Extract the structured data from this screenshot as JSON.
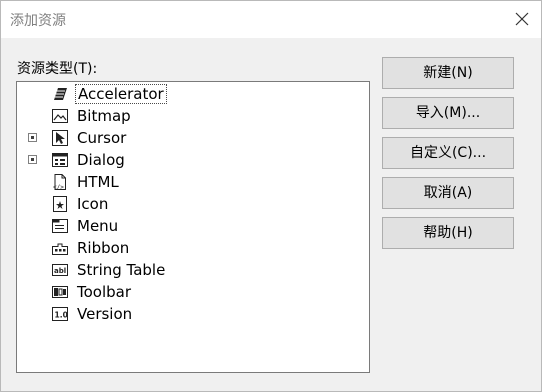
{
  "window": {
    "title": "添加资源"
  },
  "resource_types_label": "资源类型(T):",
  "tree": {
    "items": [
      {
        "label": "Accelerator",
        "icon": "accelerator-icon",
        "selected": true,
        "expandable": false
      },
      {
        "label": "Bitmap",
        "icon": "bitmap-icon",
        "selected": false,
        "expandable": false
      },
      {
        "label": "Cursor",
        "icon": "cursor-icon",
        "selected": false,
        "expandable": true
      },
      {
        "label": "Dialog",
        "icon": "dialog-icon",
        "selected": false,
        "expandable": true
      },
      {
        "label": "HTML",
        "icon": "html-icon",
        "selected": false,
        "expandable": false
      },
      {
        "label": "Icon",
        "icon": "icon-resource-icon",
        "selected": false,
        "expandable": false
      },
      {
        "label": "Menu",
        "icon": "menu-icon",
        "selected": false,
        "expandable": false
      },
      {
        "label": "Ribbon",
        "icon": "ribbon-icon",
        "selected": false,
        "expandable": false
      },
      {
        "label": "String Table",
        "icon": "string-table-icon",
        "selected": false,
        "expandable": false
      },
      {
        "label": "Toolbar",
        "icon": "toolbar-icon",
        "selected": false,
        "expandable": false
      },
      {
        "label": "Version",
        "icon": "version-icon",
        "selected": false,
        "expandable": false
      }
    ]
  },
  "buttons": {
    "new": "新建(N)",
    "import": "导入(M)...",
    "custom": "自定义(C)...",
    "cancel": "取消(A)",
    "help": "帮助(H)"
  },
  "colors": {
    "background": "#f0f0f0",
    "button_face": "#e1e1e1",
    "button_border": "#adadad"
  }
}
